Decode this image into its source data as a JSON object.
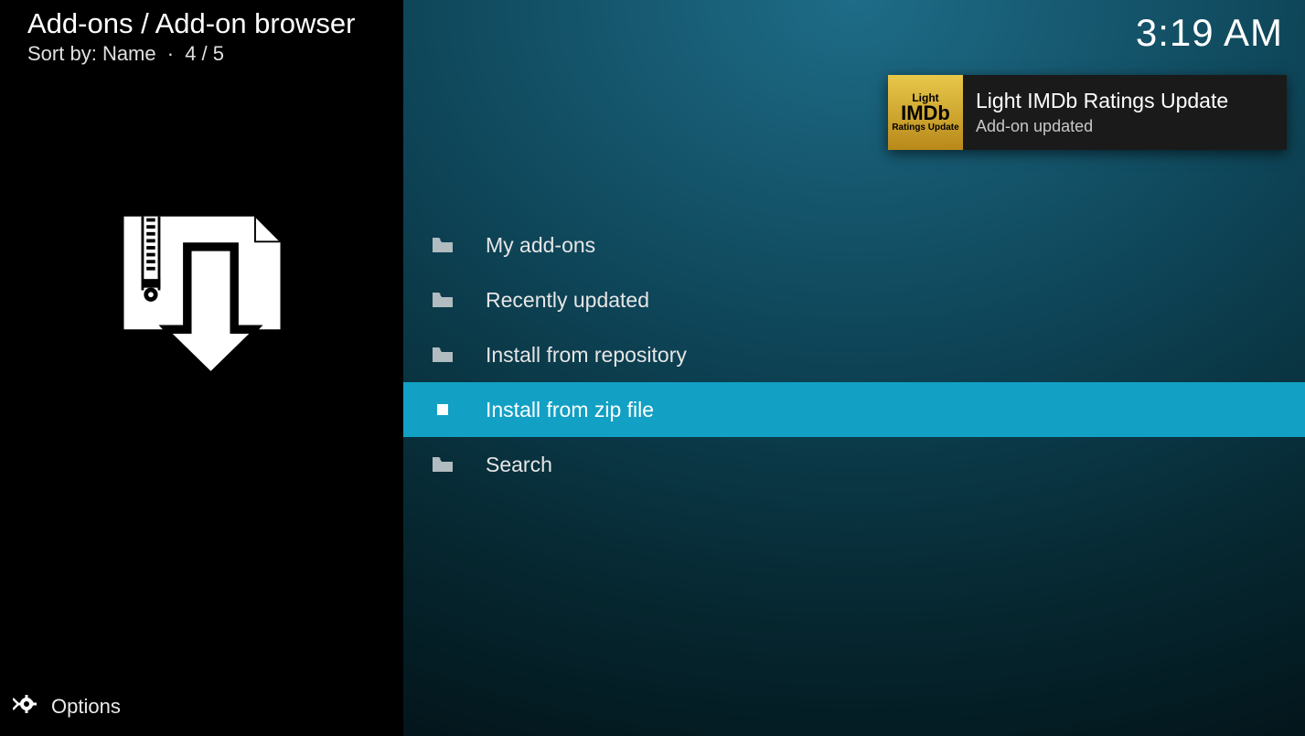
{
  "header": {
    "breadcrumb": "Add-ons / Add-on browser",
    "sort_label": "Sort by:",
    "sort_value": "Name",
    "position": "4 / 5"
  },
  "clock": "3:19 AM",
  "toast": {
    "icon_line1": "Light",
    "icon_line2": "IMDb",
    "icon_line3": "Ratings Update",
    "title": "Light IMDb Ratings Update",
    "subtitle": "Add-on updated"
  },
  "menu": {
    "items": [
      {
        "icon": "folder",
        "label": "My add-ons",
        "selected": false
      },
      {
        "icon": "folder",
        "label": "Recently updated",
        "selected": false
      },
      {
        "icon": "folder",
        "label": "Install from repository",
        "selected": false
      },
      {
        "icon": "file",
        "label": "Install from zip file",
        "selected": true
      },
      {
        "icon": "folder",
        "label": "Search",
        "selected": false
      }
    ]
  },
  "footer": {
    "options_label": "Options"
  }
}
